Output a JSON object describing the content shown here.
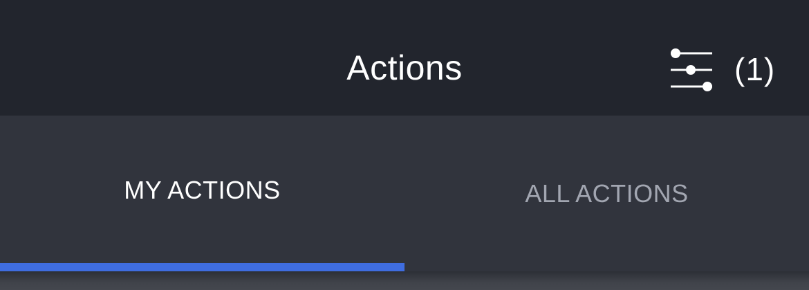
{
  "header": {
    "title": "Actions",
    "filter_count": "(1)",
    "filter_icon": "sliders-filter-icon"
  },
  "tabs": [
    {
      "label": "MY ACTIONS",
      "selected": true
    },
    {
      "label": "ALL ACTIONS",
      "selected": false
    }
  ],
  "colors": {
    "header_bg": "#22252d",
    "tabs_bg": "#31343d",
    "active_tab_text": "#ffffff",
    "inactive_tab_text": "#a2a6b1",
    "indicator": "#3f6de0"
  }
}
